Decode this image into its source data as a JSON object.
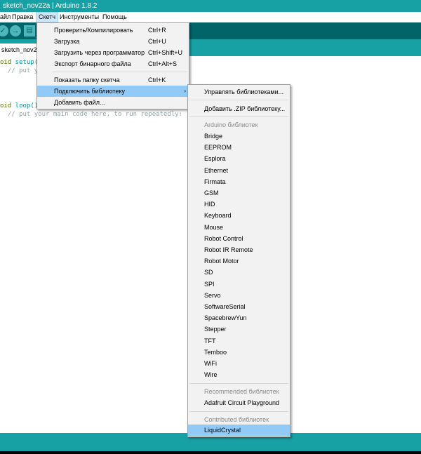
{
  "window": {
    "title": "sketch_nov22a | Arduino 1.8.2"
  },
  "menubar": {
    "items": [
      "айл",
      "Правка",
      "Скетч",
      "Инструменты",
      "Помощь"
    ],
    "active_index": 2
  },
  "toolbar": {
    "verify_icon": "✓",
    "upload_icon": "→",
    "new_icon": "▤"
  },
  "tab": {
    "label": "sketch_nov2"
  },
  "editor": {
    "lines": [
      {
        "kw": "oid",
        "fn": " setup(",
        "rest": ""
      },
      {
        "comment": "  // put yo"
      },
      {
        "text": ""
      },
      {
        "text": ""
      },
      {
        "kw": "oid",
        "fn": " loop()",
        "rest": ""
      },
      {
        "comment": "  // put your main code here, to run repeatedly:"
      }
    ]
  },
  "sketch_menu": {
    "items": [
      {
        "label": "Проверить/Компилировать",
        "shortcut": "Ctrl+R"
      },
      {
        "label": "Загрузка",
        "shortcut": "Ctrl+U"
      },
      {
        "label": "Загрузить через программатор",
        "shortcut": "Ctrl+Shift+U"
      },
      {
        "label": "Экспорт бинарного файла",
        "shortcut": "Ctrl+Alt+S"
      },
      {
        "label": "Показать папку скетча",
        "shortcut": "Ctrl+K"
      },
      {
        "label": "Подключить библиотеку",
        "shortcut": "",
        "arrow": "›"
      },
      {
        "label": "Добавить файл...",
        "shortcut": ""
      }
    ]
  },
  "library_menu": {
    "manage": "Управлять библиотеками...",
    "add_zip": "Добавить .ZIP библиотеку...",
    "arduino_header": "Arduino библиотек",
    "arduino_libs": [
      "Bridge",
      "EEPROM",
      "Esplora",
      "Ethernet",
      "Firmata",
      "GSM",
      "HID",
      "Keyboard",
      "Mouse",
      "Robot Control",
      "Robot IR Remote",
      "Robot Motor",
      "SD",
      "SPI",
      "Servo",
      "SoftwareSerial",
      "SpacebrewYun",
      "Stepper",
      "TFT",
      "Temboo",
      "WiFi",
      "Wire"
    ],
    "recommended_header": "Recommended библиотек",
    "recommended_libs": [
      "Adafruit Circuit Playground"
    ],
    "contributed_header": "Contributed библиотек",
    "contributed_libs": [
      "LiquidCrystal"
    ]
  }
}
